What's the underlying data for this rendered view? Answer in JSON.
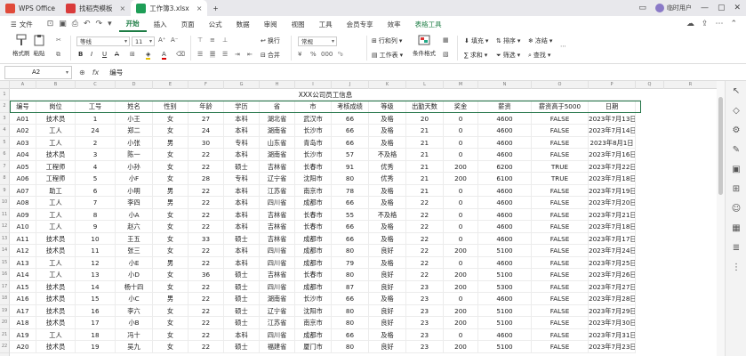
{
  "titlebar": {
    "tabs": [
      {
        "label": "WPS Office",
        "color": "#e04a3a"
      },
      {
        "label": "找稻壳模板",
        "color": "#d93b3b"
      },
      {
        "label": "工作簿3.xlsx",
        "color": "#1e9e57",
        "active": true
      }
    ],
    "user": "临时用户"
  },
  "ribbon": {
    "file": "文件",
    "tabs": [
      "开始",
      "插入",
      "页面",
      "公式",
      "数据",
      "审阅",
      "视图",
      "工具",
      "会员专享",
      "效率",
      "表格工具"
    ],
    "active_tab": "开始"
  },
  "toolbar": {
    "format_painter": "格式刷",
    "paste": "粘贴",
    "font": "等线",
    "font_size": "11",
    "wrap": "换行",
    "merge": "合并",
    "number_format": "常规",
    "row_col": "行和列",
    "worksheet": "工作表",
    "cond_format": "条件格式",
    "fill": "填充",
    "sort": "排序",
    "freeze": "冻结",
    "sum": "求和",
    "filter": "筛选",
    "find": "查找"
  },
  "formula_bar": {
    "cell_ref": "A2",
    "content": "编号"
  },
  "sheet": {
    "columns": [
      "A",
      "B",
      "C",
      "D",
      "E",
      "F",
      "G",
      "H",
      "I",
      "J",
      "K",
      "L",
      "M",
      "N",
      "O",
      "P",
      "Q",
      "R"
    ],
    "title": "XXX公司员工信息",
    "headers": [
      "编号",
      "岗位",
      "工号",
      "姓名",
      "性别",
      "年龄",
      "学历",
      "省",
      "市",
      "考核成绩",
      "等级",
      "出勤天数",
      "奖金",
      "薪资",
      "薪资高于5000",
      "日期"
    ],
    "rows": [
      [
        "A01",
        "技术员",
        "1",
        "小王",
        "女",
        "27",
        "本科",
        "湖北省",
        "武汉市",
        "66",
        "及格",
        "20",
        "0",
        "4600",
        "FALSE",
        "2023年7月13日"
      ],
      [
        "A02",
        "工人",
        "24",
        "郑二",
        "女",
        "24",
        "本科",
        "湖南省",
        "长沙市",
        "66",
        "及格",
        "21",
        "0",
        "4600",
        "FALSE",
        "2023年7月14日"
      ],
      [
        "A03",
        "工人",
        "2",
        "小张",
        "男",
        "30",
        "专科",
        "山东省",
        "青岛市",
        "66",
        "及格",
        "21",
        "0",
        "4600",
        "FALSE",
        "2023年8月1日"
      ],
      [
        "A04",
        "技术员",
        "3",
        "陈一",
        "女",
        "22",
        "本科",
        "湖南省",
        "长沙市",
        "57",
        "不及格",
        "21",
        "0",
        "4600",
        "FALSE",
        "2023年7月16日"
      ],
      [
        "A05",
        "工程师",
        "4",
        "小孙",
        "女",
        "22",
        "硕士",
        "吉林省",
        "长春市",
        "91",
        "优秀",
        "21",
        "200",
        "6200",
        "TRUE",
        "2023年7月22日"
      ],
      [
        "A06",
        "工程师",
        "5",
        "小F",
        "女",
        "28",
        "专科",
        "辽宁省",
        "沈阳市",
        "80",
        "优秀",
        "21",
        "200",
        "6100",
        "TRUE",
        "2023年7月18日"
      ],
      [
        "A07",
        "助工",
        "6",
        "小明",
        "男",
        "22",
        "本科",
        "江苏省",
        "南京市",
        "78",
        "及格",
        "21",
        "0",
        "4600",
        "FALSE",
        "2023年7月19日"
      ],
      [
        "A08",
        "工人",
        "7",
        "李四",
        "男",
        "22",
        "本科",
        "四川省",
        "成都市",
        "66",
        "及格",
        "22",
        "0",
        "4600",
        "FALSE",
        "2023年7月20日"
      ],
      [
        "A09",
        "工人",
        "8",
        "小A",
        "女",
        "22",
        "本科",
        "吉林省",
        "长春市",
        "55",
        "不及格",
        "22",
        "0",
        "4600",
        "FALSE",
        "2023年7月21日"
      ],
      [
        "A10",
        "工人",
        "9",
        "赵六",
        "女",
        "22",
        "本科",
        "吉林省",
        "长春市",
        "66",
        "及格",
        "22",
        "0",
        "4600",
        "FALSE",
        "2023年7月18日"
      ],
      [
        "A11",
        "技术员",
        "10",
        "王五",
        "女",
        "33",
        "硕士",
        "吉林省",
        "成都市",
        "66",
        "及格",
        "22",
        "0",
        "4600",
        "FALSE",
        "2023年7月17日"
      ],
      [
        "A12",
        "技术员",
        "11",
        "张三",
        "女",
        "22",
        "本科",
        "四川省",
        "成都市",
        "80",
        "良好",
        "22",
        "200",
        "5100",
        "FALSE",
        "2023年7月24日"
      ],
      [
        "A13",
        "工人",
        "12",
        "小E",
        "男",
        "22",
        "本科",
        "四川省",
        "成都市",
        "79",
        "及格",
        "22",
        "0",
        "4600",
        "FALSE",
        "2023年7月25日"
      ],
      [
        "A14",
        "工人",
        "13",
        "小D",
        "女",
        "36",
        "硕士",
        "吉林省",
        "长春市",
        "80",
        "良好",
        "22",
        "200",
        "5100",
        "FALSE",
        "2023年7月26日"
      ],
      [
        "A15",
        "技术员",
        "14",
        "杨十四",
        "女",
        "22",
        "硕士",
        "四川省",
        "成都市",
        "87",
        "良好",
        "23",
        "200",
        "5300",
        "FALSE",
        "2023年7月27日"
      ],
      [
        "A16",
        "技术员",
        "15",
        "小C",
        "男",
        "22",
        "硕士",
        "湖南省",
        "长沙市",
        "66",
        "及格",
        "23",
        "0",
        "4600",
        "FALSE",
        "2023年7月28日"
      ],
      [
        "A17",
        "技术员",
        "16",
        "李六",
        "女",
        "22",
        "硕士",
        "辽宁省",
        "沈阳市",
        "80",
        "良好",
        "23",
        "200",
        "5100",
        "FALSE",
        "2023年7月29日"
      ],
      [
        "A18",
        "技术员",
        "17",
        "小B",
        "女",
        "22",
        "硕士",
        "江苏省",
        "南京市",
        "80",
        "良好",
        "23",
        "200",
        "5100",
        "FALSE",
        "2023年7月30日"
      ],
      [
        "A19",
        "工人",
        "18",
        "冯十",
        "女",
        "22",
        "本科",
        "四川省",
        "成都市",
        "66",
        "及格",
        "23",
        "0",
        "4600",
        "FALSE",
        "2023年7月31日"
      ],
      [
        "A20",
        "技术员",
        "19",
        "吴九",
        "女",
        "22",
        "硕士",
        "福建省",
        "厦门市",
        "80",
        "良好",
        "23",
        "200",
        "5100",
        "FALSE",
        "2023年7月23日"
      ]
    ]
  },
  "colors": {
    "accent": "#1e7d45",
    "selection": "#217346"
  }
}
